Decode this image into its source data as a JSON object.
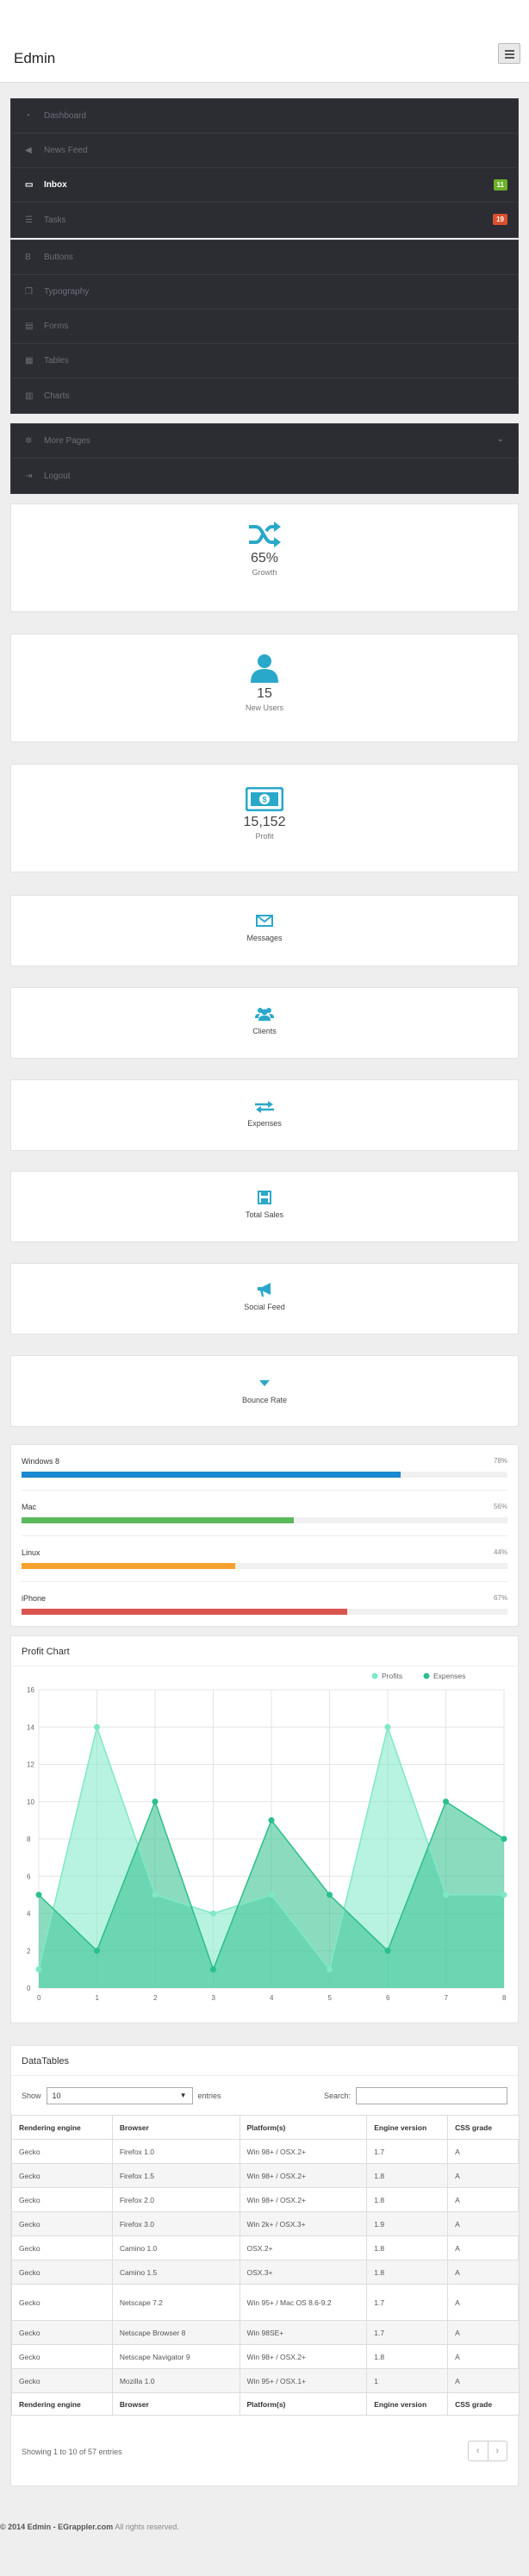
{
  "header": {
    "brand": "Edmin"
  },
  "nav": {
    "group1": [
      {
        "label": "Dashboard",
        "icon": "dashboard-icon"
      },
      {
        "label": "News Feed",
        "icon": "bullhorn-icon"
      },
      {
        "label": "Inbox",
        "icon": "inbox-icon",
        "badge": "11",
        "active": true
      },
      {
        "label": "Tasks",
        "icon": "tasks-icon",
        "badge": "19"
      }
    ],
    "group2": [
      {
        "label": "Buttons",
        "icon": "bold-icon"
      },
      {
        "label": "Typography",
        "icon": "book-icon"
      },
      {
        "label": "Forms",
        "icon": "paste-icon"
      },
      {
        "label": "Tables",
        "icon": "table-icon"
      },
      {
        "label": "Charts",
        "icon": "bar-chart-icon"
      }
    ],
    "group3": [
      {
        "label": "More Pages",
        "icon": "cog-icon"
      },
      {
        "label": "Logout",
        "icon": "signout-icon"
      }
    ]
  },
  "stats": {
    "growth": {
      "value": "65%",
      "label": "Growth"
    },
    "new_users": {
      "value": "15",
      "label": "New Users"
    },
    "profit": {
      "value": "15,152",
      "label": "Profit"
    }
  },
  "shortcuts": [
    "Messages",
    "Clients",
    "Expenses",
    "Total Sales",
    "Social Feed",
    "Bounce Rate"
  ],
  "progress": [
    {
      "name": "Windows 8",
      "pct_text": "78%",
      "pct": 78,
      "color": "#1a8ad0"
    },
    {
      "name": "Mac",
      "pct_text": "56%",
      "pct": 56,
      "color": "#5cb85c"
    },
    {
      "name": "Linux",
      "pct_text": "44%",
      "pct": 44,
      "color": "#f7a22e"
    },
    {
      "name": "iPhone",
      "pct_text": "67%",
      "pct": 67,
      "color": "#d9534f"
    }
  ],
  "profit_chart": {
    "title": "Profit Chart"
  },
  "chart_data": {
    "type": "area",
    "title": "Profit Chart",
    "x": [
      0,
      1,
      2,
      3,
      4,
      5,
      6,
      7,
      8
    ],
    "ylim": [
      0,
      16
    ],
    "yticks": [
      0,
      2,
      4,
      6,
      8,
      10,
      12,
      14,
      16
    ],
    "grid": true,
    "legend_position": "top-right",
    "series": [
      {
        "name": "Profits",
        "values": [
          1,
          14,
          5,
          4,
          5,
          1,
          14,
          5,
          5
        ],
        "color": "#7ee8c8"
      },
      {
        "name": "Expenses",
        "values": [
          5,
          2,
          10,
          1,
          9,
          5,
          2,
          10,
          8
        ],
        "color": "#2bbf8a"
      }
    ]
  },
  "datatable": {
    "title": "DataTables",
    "show_label": "Show",
    "show_value": "10",
    "entries_label": "entries",
    "search_label": "Search:",
    "columns": [
      "Rendering engine",
      "Browser",
      "Platform(s)",
      "Engine version",
      "CSS grade"
    ],
    "rows": [
      [
        "Gecko",
        "Firefox 1.0",
        "Win 98+ / OSX.2+",
        "1.7",
        "A"
      ],
      [
        "Gecko",
        "Firefox 1.5",
        "Win 98+ / OSX.2+",
        "1.8",
        "A"
      ],
      [
        "Gecko",
        "Firefox 2.0",
        "Win 98+ / OSX.2+",
        "1.8",
        "A"
      ],
      [
        "Gecko",
        "Firefox 3.0",
        "Win 2k+ / OSX.3+",
        "1.9",
        "A"
      ],
      [
        "Gecko",
        "Camino 1.0",
        "OSX.2+",
        "1.8",
        "A"
      ],
      [
        "Gecko",
        "Camino 1.5",
        "OSX.3+",
        "1.8",
        "A"
      ],
      [
        "Gecko",
        "Netscape 7.2",
        "Win 95+ / Mac OS 8.6-9.2",
        "1.7",
        "A"
      ],
      [
        "Gecko",
        "Netscape Browser 8",
        "Win 98SE+",
        "1.7",
        "A"
      ],
      [
        "Gecko",
        "Netscape Navigator 9",
        "Win 98+ / OSX.2+",
        "1.8",
        "A"
      ],
      [
        "Gecko",
        "Mozilla 1.0",
        "Win 95+ / OSX.1+",
        "1",
        "A"
      ]
    ],
    "showing": "Showing 1 to 10 of 57 entries",
    "prev": "‹",
    "next": "›"
  },
  "footer": {
    "brand": "© 2014 Edmin - EGrappler.com",
    "rights": " All rights reserved."
  }
}
